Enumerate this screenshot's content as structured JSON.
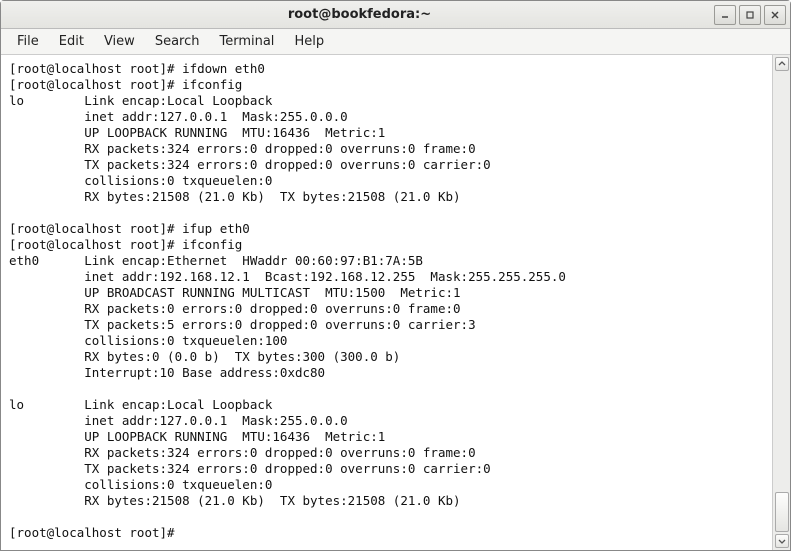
{
  "window": {
    "title": "root@bookfedora:~"
  },
  "menu": {
    "file": "File",
    "edit": "Edit",
    "view": "View",
    "search": "Search",
    "terminal": "Terminal",
    "help": "Help"
  },
  "terminal": {
    "lines": [
      "[root@localhost root]# ifdown eth0",
      "[root@localhost root]# ifconfig",
      "lo        Link encap:Local Loopback",
      "          inet addr:127.0.0.1  Mask:255.0.0.0",
      "          UP LOOPBACK RUNNING  MTU:16436  Metric:1",
      "          RX packets:324 errors:0 dropped:0 overruns:0 frame:0",
      "          TX packets:324 errors:0 dropped:0 overruns:0 carrier:0",
      "          collisions:0 txqueuelen:0",
      "          RX bytes:21508 (21.0 Kb)  TX bytes:21508 (21.0 Kb)",
      "",
      "[root@localhost root]# ifup eth0",
      "[root@localhost root]# ifconfig",
      "eth0      Link encap:Ethernet  HWaddr 00:60:97:B1:7A:5B",
      "          inet addr:192.168.12.1  Bcast:192.168.12.255  Mask:255.255.255.0",
      "          UP BROADCAST RUNNING MULTICAST  MTU:1500  Metric:1",
      "          RX packets:0 errors:0 dropped:0 overruns:0 frame:0",
      "          TX packets:5 errors:0 dropped:0 overruns:0 carrier:3",
      "          collisions:0 txqueuelen:100",
      "          RX bytes:0 (0.0 b)  TX bytes:300 (300.0 b)",
      "          Interrupt:10 Base address:0xdc80",
      "",
      "lo        Link encap:Local Loopback",
      "          inet addr:127.0.0.1  Mask:255.0.0.0",
      "          UP LOOPBACK RUNNING  MTU:16436  Metric:1",
      "          RX packets:324 errors:0 dropped:0 overruns:0 frame:0",
      "          TX packets:324 errors:0 dropped:0 overruns:0 carrier:0",
      "          collisions:0 txqueuelen:0",
      "          RX bytes:21508 (21.0 Kb)  TX bytes:21508 (21.0 Kb)",
      "",
      "[root@localhost root]#"
    ]
  }
}
